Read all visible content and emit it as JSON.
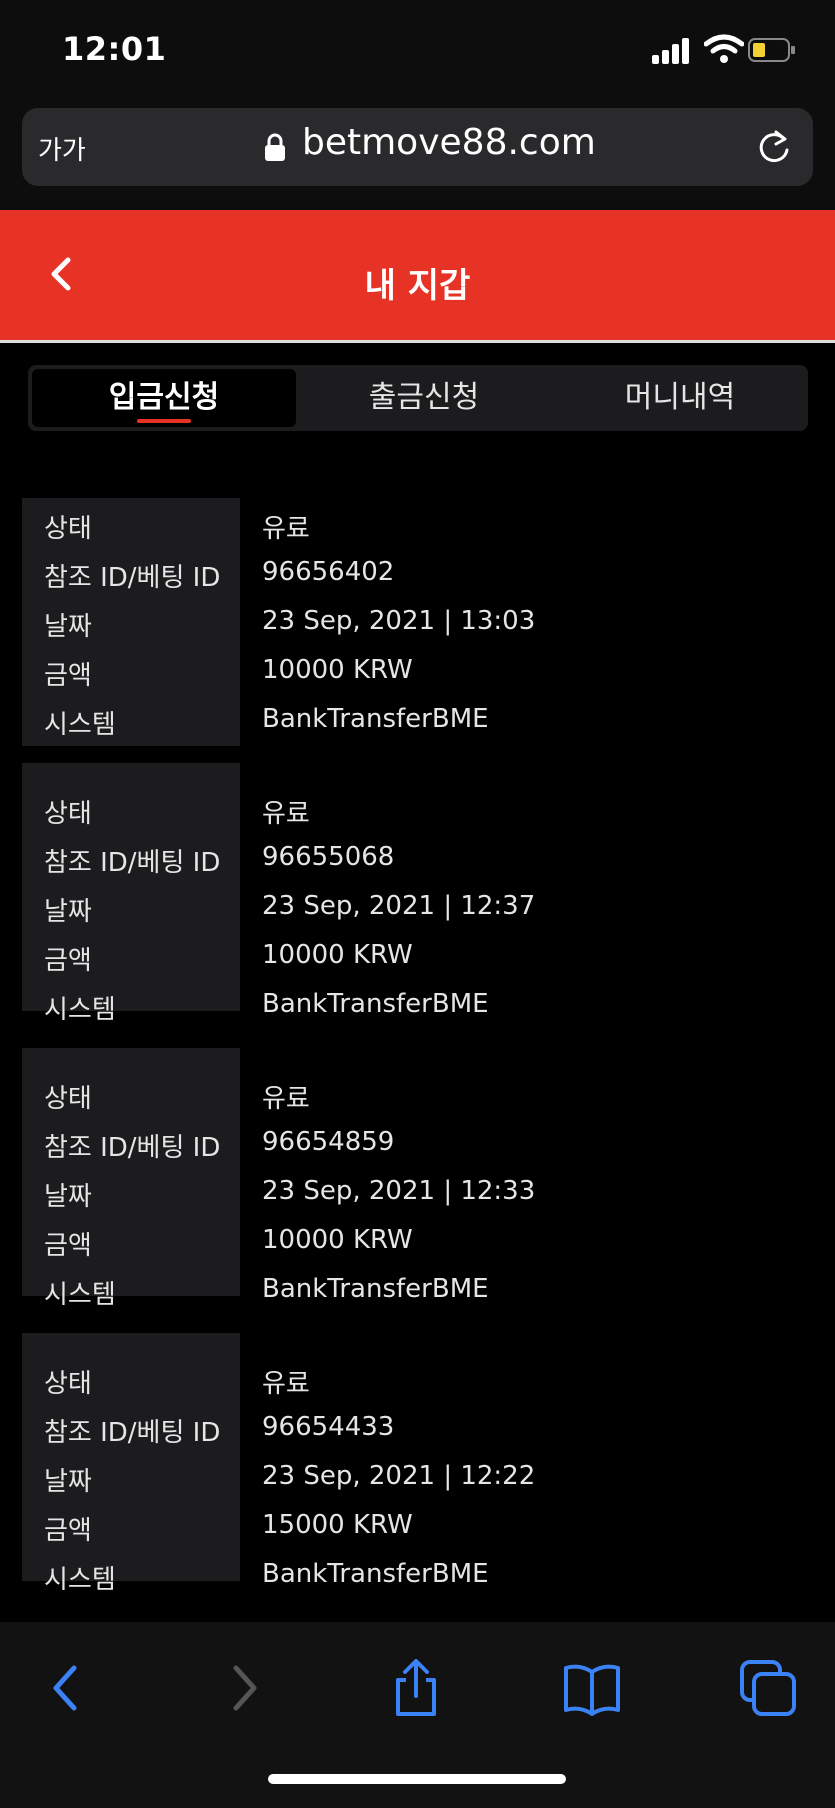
{
  "status_bar": {
    "time": "12:01"
  },
  "browser": {
    "text_size_label": "가가",
    "url": "betmove88.com"
  },
  "header": {
    "title": "내 지갑"
  },
  "tabs": [
    {
      "label": "입금신청",
      "active": true
    },
    {
      "label": "출금신청",
      "active": false
    },
    {
      "label": "머니내역",
      "active": false
    }
  ],
  "transactions": [
    {
      "status_label": "상태",
      "status": "유료",
      "ref_label": "참조 ID/베팅 ID",
      "ref_id": "96656402",
      "date_label": "날짜",
      "date": "23 Sep, 2021 | 13:03",
      "amount_label": "금액",
      "amount": "10000 KRW",
      "system_label": "시스템",
      "system": "BankTransferBME"
    },
    {
      "status_label": "상태",
      "status": "유료",
      "ref_label": "참조 ID/베팅 ID",
      "ref_id": "96655068",
      "date_label": "날짜",
      "date": "23 Sep, 2021 | 12:37",
      "amount_label": "금액",
      "amount": "10000 KRW",
      "system_label": "시스템",
      "system": "BankTransferBME"
    },
    {
      "status_label": "상태",
      "status": "유료",
      "ref_label": "참조 ID/베팅 ID",
      "ref_id": "96654859",
      "date_label": "날짜",
      "date": "23 Sep, 2021 | 12:33",
      "amount_label": "금액",
      "amount": "10000 KRW",
      "system_label": "시스템",
      "system": "BankTransferBME"
    },
    {
      "status_label": "상태",
      "status": "유료",
      "ref_label": "참조 ID/베팅 ID",
      "ref_id": "96654433",
      "date_label": "날짜",
      "date": "23 Sep, 2021 | 12:22",
      "amount_label": "금액",
      "amount": "15000 KRW",
      "system_label": "시스템",
      "system": "BankTransferBME"
    }
  ],
  "colors": {
    "accent": "#e63325",
    "toolbar_icon": "#3b82f6",
    "battery": "#f5d033"
  },
  "icons": [
    "signal-icon",
    "wifi-icon",
    "battery-icon",
    "lock-icon",
    "reload-icon",
    "back-arrow-icon",
    "browser-back-icon",
    "browser-forward-icon",
    "share-icon",
    "bookmarks-icon",
    "tabs-icon"
  ]
}
